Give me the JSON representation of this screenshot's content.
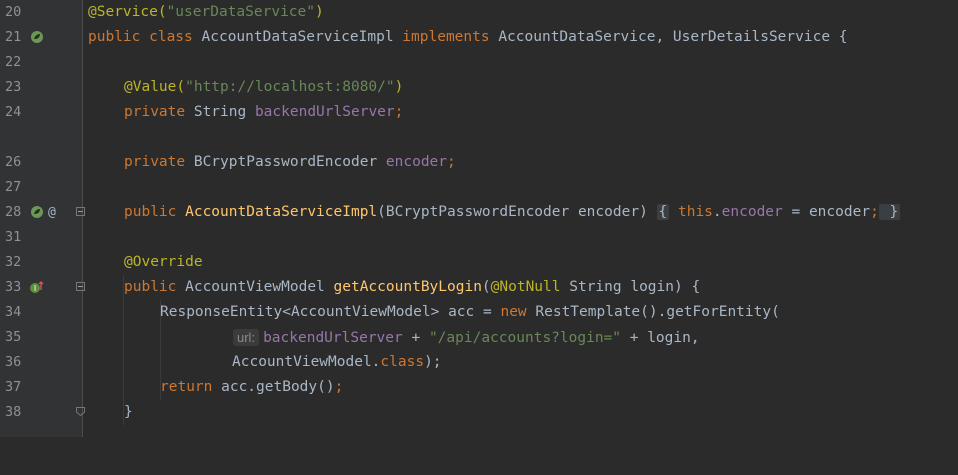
{
  "gutter": {
    "line_numbers": [
      "20",
      "21",
      "22",
      "23",
      "24",
      "26",
      "27",
      "28",
      "31",
      "32",
      "33",
      "34",
      "35",
      "36",
      "37",
      "38"
    ],
    "icons": {
      "l21": "spring-bean-icon",
      "l28_a": "spring-bean-icon",
      "l28_b": "at-sign",
      "l33": "override-method-icon"
    },
    "at_symbol": "@"
  },
  "code": {
    "l20": {
      "ann": "@Service(",
      "str": "\"userDataService\"",
      "close": ")"
    },
    "l21": {
      "kw1": "public class ",
      "name": "AccountDataServiceImpl ",
      "kw2": "implements ",
      "rest": "AccountDataService, UserDetailsService {"
    },
    "l23": {
      "ann": "@Value(",
      "str": "\"http://localhost:8080/\"",
      "close": ")"
    },
    "l24": {
      "kw": "private ",
      "type": "String ",
      "fld": "backendUrlServer",
      "semi": ";"
    },
    "l26": {
      "kw": "private ",
      "type": "BCryptPasswordEncoder ",
      "fld": "encoder",
      "semi": ";"
    },
    "l28": {
      "kw": "public ",
      "mth": "AccountDataServiceImpl",
      "params": "(BCryptPasswordEncoder encoder) ",
      "ob": "{",
      "kw2": " this",
      ".": ".",
      "fld": "encoder",
      "rest": " = encoder",
      "semi": ";",
      "cb": " }"
    },
    "l32": {
      "ann": "@Override"
    },
    "l33": {
      "kw": "public ",
      "type": "AccountViewModel ",
      "mth": "getAccountByLogin",
      "open": "(",
      "ann": "@NotNull",
      "rest": " String login) {"
    },
    "l34": {
      "text": "ResponseEntity<AccountViewModel> acc = ",
      "kw": "new ",
      "rest": "RestTemplate().getForEntity("
    },
    "l35": {
      "hint": "url:",
      "fld": "backendUrlServer",
      "plus": " + ",
      "str": "\"/api/accounts?login=\"",
      "rest": " + login,"
    },
    "l36": {
      "text": "AccountViewModel.",
      "kw": "class",
      "rest": ");"
    },
    "l37": {
      "kw": "return ",
      "rest": "acc.getBody()",
      "semi": ";"
    },
    "l38": {
      "text": "}"
    }
  },
  "colors": {
    "background": "#2b2b2b",
    "gutter": "#313335",
    "keyword": "#cc7832",
    "annotation": "#bbb529",
    "string": "#6a8759",
    "field": "#9876aa",
    "method": "#ffc66d",
    "text": "#a9b7c6"
  }
}
